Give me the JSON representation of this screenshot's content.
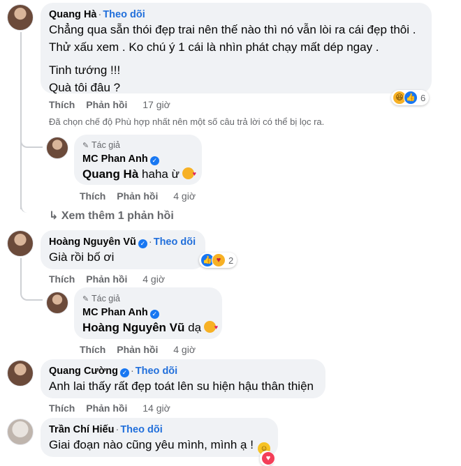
{
  "comments": [
    {
      "name": "Quang Hà",
      "follow": "Theo dõi",
      "lines": [
        "Chẳng qua sẵn thói đẹp trai nên thế nào thì nó vẫn lòi ra cái đẹp thôi .",
        "Thử xấu xem . Ko chú ý 1 cái là nhìn phát chạy mất dép ngay .",
        "Tinh tướng !!!",
        "Quà tôi đâu ?"
      ],
      "like": "Thích",
      "reply": "Phản hồi",
      "time": "17 giờ",
      "reaction_count": "6"
    },
    {
      "name": "Hoàng Nguyên Vũ",
      "follow": "Theo dõi",
      "text": "Già rồi bố ơi",
      "like": "Thích",
      "reply": "Phản hồi",
      "time": "4 giờ",
      "reaction_count": "2"
    },
    {
      "name": "Quang Cường",
      "follow": "Theo dõi",
      "text": "Anh lai thấy rất đẹp toát lên su hiện hậu thân thiện",
      "like": "Thích",
      "reply": "Phản hồi",
      "time": "14 giờ"
    },
    {
      "name": "Trần Chí Hiếu",
      "follow": "Theo dõi",
      "text": "Giai đoạn nào cũng yêu mình, mình ạ !"
    }
  ],
  "filter_note": "Đã chọn chế độ Phù hợp nhất nên một số câu trả lời có thể bị lọc ra.",
  "more_replies": "Xem thêm 1 phản hồi",
  "replies": [
    {
      "author_tag": "Tác giả",
      "name": "MC Phan Anh",
      "mention": "Quang Hà",
      "text": "haha ừ",
      "like": "Thích",
      "reply": "Phản hồi",
      "time": "4 giờ"
    },
    {
      "author_tag": "Tác giả",
      "name": "MC Phan Anh",
      "mention": "Hoàng Nguyên Vũ",
      "text": "dạ",
      "like": "Thích",
      "reply": "Phản hồi",
      "time": "4 giờ"
    }
  ],
  "colors": {
    "bubble": "#f0f2f5",
    "follow": "#216fdb",
    "meta": "#65676b",
    "verified": "#1877f2"
  }
}
